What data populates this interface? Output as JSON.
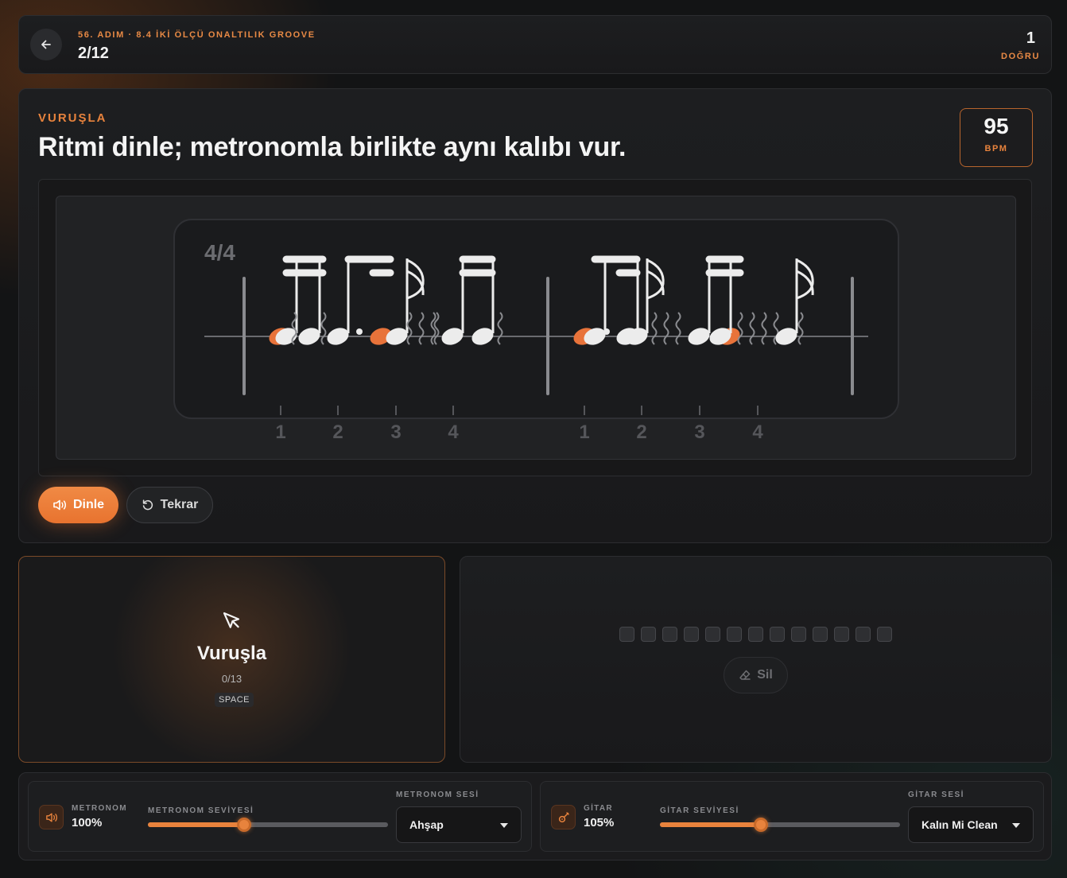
{
  "header": {
    "step_label": "56. ADIM · 8.4 İKİ ÖLÇÜ ONALTILIK GROOVE",
    "progress": "2/12",
    "correct_count": "1",
    "correct_label": "DOĞRU"
  },
  "exercise": {
    "mode_label": "VURUŞLA",
    "instruction": "Ritmi dinle; metronomla birlikte aynı kalıbı vur.",
    "bpm_value": "95",
    "bpm_unit": "BPM",
    "time_signature": "4/4",
    "beat_numbers": [
      "1",
      "2",
      "3",
      "4",
      "1",
      "2",
      "3",
      "4"
    ],
    "listen_label": "Dinle",
    "repeat_label": "Tekrar",
    "accent_color": "#e8733a"
  },
  "tap_pad": {
    "title": "Vuruşla",
    "count": "0/13",
    "key_hint": "SPACE"
  },
  "hits": {
    "slot_count": 13,
    "clear_label": "Sil"
  },
  "mixer": {
    "metronome": {
      "name": "METRONOM",
      "percent": "100%",
      "level_label": "METRONOM SEVİYESİ",
      "level": 0.4,
      "sound_label": "METRONOM SESİ",
      "sound_value": "Ahşap"
    },
    "guitar": {
      "name": "GİTAR",
      "percent": "105%",
      "level_label": "GİTAR SEVİYESİ",
      "level": 0.42,
      "sound_label": "GİTAR SESİ",
      "sound_value": "Kalın Mi Clean"
    }
  }
}
